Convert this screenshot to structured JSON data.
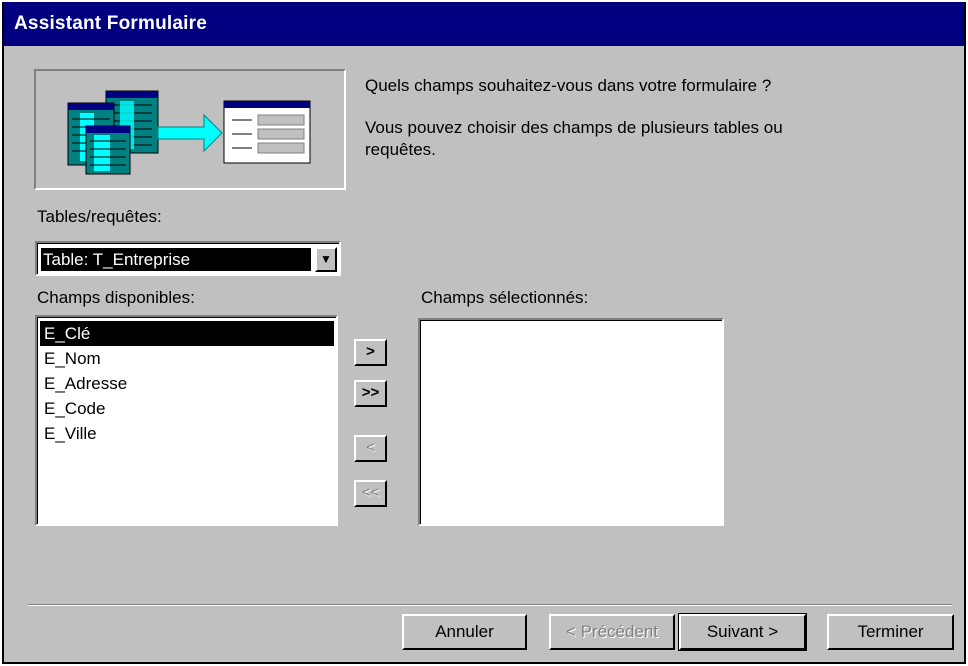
{
  "window": {
    "title": "Assistant Formulaire"
  },
  "intro": {
    "question": "Quels champs souhaitez-vous dans votre formulaire ?",
    "hint_line1": "Vous pouvez choisir des champs de plusieurs tables ou",
    "hint_line2": "requêtes."
  },
  "source": {
    "label": "Tables/requêtes:",
    "selected": "Table: T_Entreprise"
  },
  "available": {
    "label": "Champs disponibles:",
    "items": [
      "E_Clé",
      "E_Nom",
      "E_Adresse",
      "E_Code",
      "E_Ville"
    ],
    "selected_item": "E_Clé"
  },
  "selected_fields": {
    "label": "Champs sélectionnés:",
    "items": []
  },
  "move_buttons": {
    "add_one": ">",
    "add_all": ">>",
    "remove_one": "<",
    "remove_all": "<<"
  },
  "footer": {
    "cancel": "Annuler",
    "back": "< Précédent",
    "next": "Suivant >",
    "finish": "Terminer"
  },
  "colors": {
    "titlebar": "#000080",
    "dialog_face": "#c0c0c0",
    "illustration_cyan": "#00ffff",
    "illustration_blue": "#000080"
  }
}
